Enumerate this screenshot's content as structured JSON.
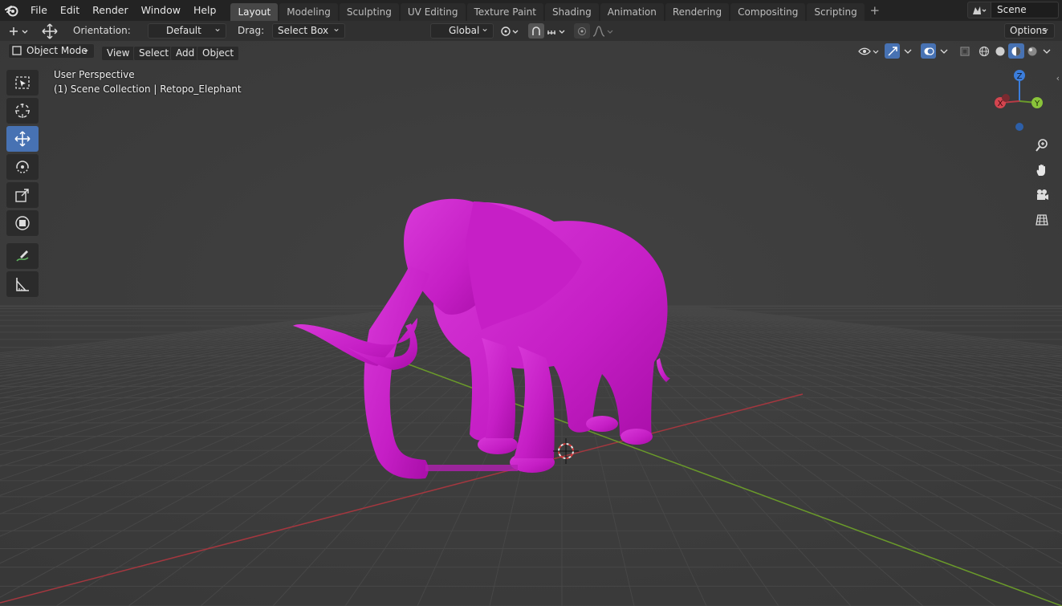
{
  "menu": [
    "File",
    "Edit",
    "Render",
    "Window",
    "Help"
  ],
  "workspaces": {
    "active": "Layout",
    "tabs": [
      "Layout",
      "Modeling",
      "Sculpting",
      "UV Editing",
      "Texture Paint",
      "Shading",
      "Animation",
      "Rendering",
      "Compositing",
      "Scripting"
    ]
  },
  "scene": {
    "name": "Scene"
  },
  "tool_settings": {
    "orientation_label": "Orientation:",
    "orientation_value": "Default",
    "drag_label": "Drag:",
    "drag_value": "Select Box",
    "transform_orientation": "Global",
    "options_label": "Options"
  },
  "viewport_header": {
    "mode": "Object Mode",
    "menus": [
      "View",
      "Select",
      "Add",
      "Object"
    ]
  },
  "viewport": {
    "perspective_label": "User Perspective",
    "collection_label": "(1) Scene Collection | Retopo_Elephant",
    "gizmo_axes": {
      "x": "X",
      "y": "Y",
      "z": "Z"
    }
  },
  "colors": {
    "accent": "#4772b3",
    "model": "#c71bc7",
    "grid_bg": "#3d3d3d",
    "x_axis": "#a4373f",
    "y_axis": "#6a9a2a",
    "z_axis": "#3b7ddb"
  },
  "toolbar_icons": [
    "select-box-icon",
    "cursor-icon",
    "move-icon",
    "rotate-icon",
    "scale-icon",
    "transform-icon",
    "annotate-icon",
    "measure-icon"
  ],
  "nav_icons": [
    "zoom-icon",
    "hand-pan-icon",
    "camera-icon",
    "grid-ortho-icon"
  ]
}
